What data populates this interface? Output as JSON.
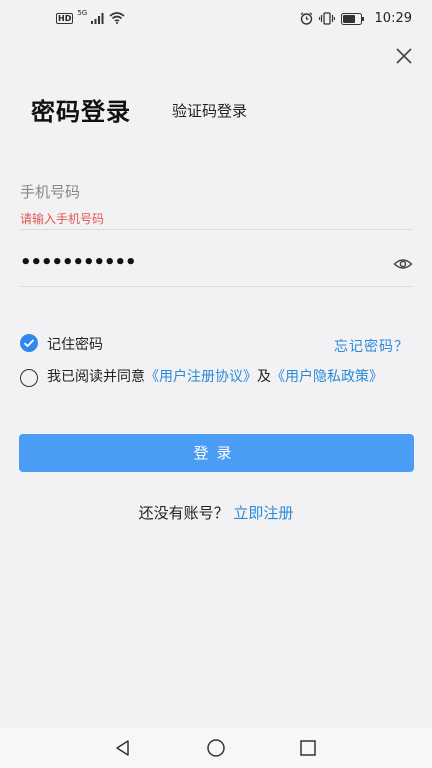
{
  "status_bar": {
    "hd_label": "HD",
    "network_label": "5G",
    "time": "10:29"
  },
  "tabs": {
    "password_login": "密码登录",
    "code_login": "验证码登录"
  },
  "phone": {
    "placeholder": "手机号码",
    "error": "请输入手机号码"
  },
  "password": {
    "masked_value": "•••••••••••"
  },
  "remember": {
    "label": "记住密码",
    "checked": true,
    "forgot_label": "忘记密码？"
  },
  "agreement": {
    "checked": false,
    "prefix": "我已阅读并同意",
    "user_agreement": "《用户注册协议》",
    "joiner": "及",
    "privacy_policy": "《用户隐私政策》"
  },
  "login_button": "登录",
  "register": {
    "prefix": "还没有账号？",
    "link": "立即注册"
  },
  "colors": {
    "accent": "#2b8ad8",
    "button": "#4a9cf5",
    "error": "#e05555"
  },
  "icons": [
    "signal-icon",
    "wifi-icon",
    "alarm-icon",
    "vibrate-icon",
    "battery-icon",
    "close-icon",
    "eye-icon",
    "checkmark-icon",
    "back-icon",
    "home-icon",
    "recents-icon"
  ]
}
